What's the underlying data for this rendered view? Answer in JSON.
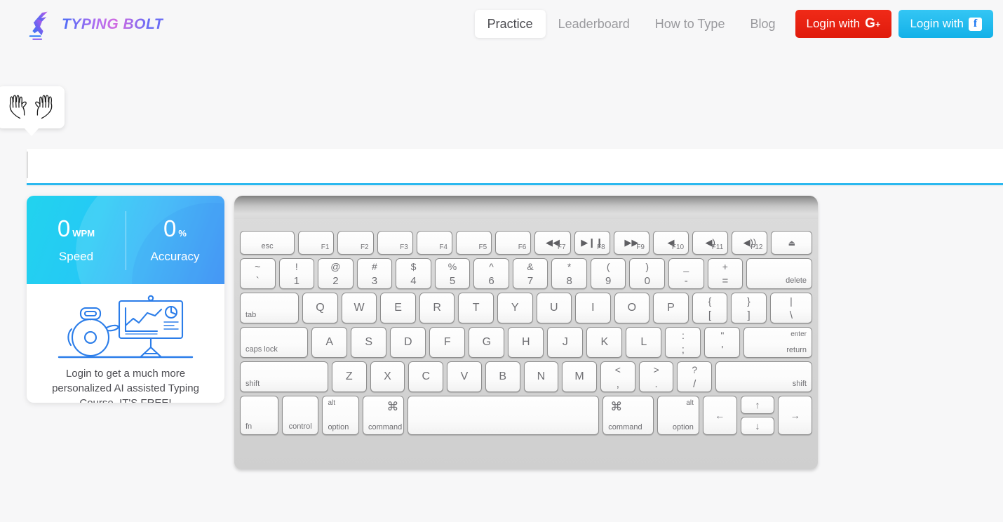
{
  "brand": {
    "name": "TYPING BOLT",
    "logo_icon": "runner-bolt-logo"
  },
  "nav": {
    "links": [
      {
        "label": "Practice",
        "active": true
      },
      {
        "label": "Leaderboard",
        "active": false
      },
      {
        "label": "How to Type",
        "active": false
      },
      {
        "label": "Blog",
        "active": false
      }
    ],
    "google_login": "Login with",
    "google_icon": "google-plus-icon",
    "facebook_login": "Login with",
    "facebook_icon": "facebook-icon"
  },
  "tooltip": {
    "icon": "two-hands-icon"
  },
  "typing_area": {
    "value": "",
    "placeholder": ""
  },
  "stats": {
    "speed": {
      "value": "0",
      "unit": "WPM",
      "label": "Speed"
    },
    "accuracy": {
      "value": "0",
      "unit": "%",
      "label": "Accuracy"
    }
  },
  "promo": {
    "illustration": "robot-presentation-chart-illustration",
    "text": "Login to get a much more personalized AI assisted Typing Course. IT'S FREE!"
  },
  "keyboard": {
    "function_row": [
      {
        "main": "esc",
        "style": "center-small",
        "flex": 1.55
      },
      {
        "fnum": "F1",
        "style": "fkey",
        "flex": 1
      },
      {
        "fnum": "F2",
        "style": "fkey",
        "flex": 1
      },
      {
        "fnum": "F3",
        "style": "fkey",
        "flex": 1
      },
      {
        "fnum": "F4",
        "style": "fkey",
        "flex": 1
      },
      {
        "fnum": "F5",
        "style": "fkey",
        "flex": 1
      },
      {
        "fnum": "F6",
        "style": "fkey",
        "flex": 1
      },
      {
        "fnum": "F7",
        "glyph": "◀◀",
        "icon": "rewind-icon",
        "style": "media",
        "flex": 1
      },
      {
        "fnum": "F8",
        "glyph": "▶❙❙",
        "icon": "play-pause-icon",
        "style": "media",
        "flex": 1
      },
      {
        "fnum": "F9",
        "glyph": "▶▶",
        "icon": "fast-forward-icon",
        "style": "media",
        "flex": 1
      },
      {
        "fnum": "F10",
        "glyph": "◀",
        "icon": "mute-icon",
        "style": "media",
        "flex": 1
      },
      {
        "fnum": "F11",
        "glyph": "◀)",
        "icon": "volume-down-icon",
        "style": "media",
        "flex": 1
      },
      {
        "fnum": "F12",
        "glyph": "◀))",
        "icon": "volume-up-icon",
        "style": "media",
        "flex": 1
      },
      {
        "glyph": "⏏",
        "icon": "eject-icon",
        "style": "center",
        "flex": 1.15
      }
    ],
    "number_row": [
      {
        "top": "~",
        "bot": "`",
        "flex": 1
      },
      {
        "top": "!",
        "bot": "1",
        "flex": 1
      },
      {
        "top": "@",
        "bot": "2",
        "flex": 1
      },
      {
        "top": "#",
        "bot": "3",
        "flex": 1
      },
      {
        "top": "$",
        "bot": "4",
        "flex": 1
      },
      {
        "top": "%",
        "bot": "5",
        "flex": 1
      },
      {
        "top": "^",
        "bot": "6",
        "flex": 1
      },
      {
        "top": "&",
        "bot": "7",
        "flex": 1
      },
      {
        "top": "*",
        "bot": "8",
        "flex": 1
      },
      {
        "top": "(",
        "bot": "9",
        "flex": 1
      },
      {
        "top": ")",
        "bot": "0",
        "flex": 1
      },
      {
        "top": "_",
        "bot": "-",
        "flex": 1
      },
      {
        "top": "+",
        "bot": "=",
        "flex": 1
      },
      {
        "main": "delete",
        "style": "pos-br",
        "flex": 1.75
      }
    ],
    "tab_row": [
      {
        "main": "tab",
        "style": "pos-bl",
        "flex": 1.55
      },
      {
        "main": "Q",
        "flex": 1
      },
      {
        "main": "W",
        "flex": 1
      },
      {
        "main": "E",
        "flex": 1
      },
      {
        "main": "R",
        "flex": 1
      },
      {
        "main": "T",
        "flex": 1
      },
      {
        "main": "Y",
        "flex": 1
      },
      {
        "main": "U",
        "flex": 1
      },
      {
        "main": "I",
        "flex": 1
      },
      {
        "main": "O",
        "flex": 1
      },
      {
        "main": "P",
        "flex": 1
      },
      {
        "top": "{",
        "bot": "[",
        "flex": 1
      },
      {
        "top": "}",
        "bot": "]",
        "flex": 1
      },
      {
        "top": "|",
        "bot": "\\",
        "flex": 1.2
      }
    ],
    "home_row": [
      {
        "main": "caps lock",
        "style": "pos-bl",
        "flex": 1.8
      },
      {
        "main": "A",
        "flex": 1
      },
      {
        "main": "S",
        "flex": 1
      },
      {
        "main": "D",
        "flex": 1
      },
      {
        "main": "F",
        "flex": 1
      },
      {
        "main": "G",
        "flex": 1
      },
      {
        "main": "H",
        "flex": 1
      },
      {
        "main": "J",
        "flex": 1
      },
      {
        "main": "K",
        "flex": 1
      },
      {
        "main": "L",
        "flex": 1
      },
      {
        "top": ":",
        "bot": ";",
        "flex": 1
      },
      {
        "top": "\"",
        "bot": "'",
        "flex": 1
      },
      {
        "tr": "enter",
        "br": "return",
        "style": "enter",
        "flex": 1.95
      }
    ],
    "shift_row": [
      {
        "main": "shift",
        "style": "pos-bl",
        "flex": 2.45
      },
      {
        "main": "Z",
        "flex": 1
      },
      {
        "main": "X",
        "flex": 1
      },
      {
        "main": "C",
        "flex": 1
      },
      {
        "main": "V",
        "flex": 1
      },
      {
        "main": "B",
        "flex": 1
      },
      {
        "main": "N",
        "flex": 1
      },
      {
        "main": "M",
        "flex": 1
      },
      {
        "top": "<",
        "bot": ",",
        "flex": 1
      },
      {
        "top": ">",
        "bot": ".",
        "flex": 1
      },
      {
        "top": "?",
        "bot": "/",
        "flex": 1
      },
      {
        "main": "shift",
        "style": "pos-br",
        "flex": 2.7
      }
    ],
    "bottom_row": [
      {
        "main": "fn",
        "style": "pos-bl",
        "flex": 1
      },
      {
        "main": "control",
        "style": "pos-bc",
        "flex": 1.1
      },
      {
        "tl": "alt",
        "bl": "option",
        "style": "corner",
        "flex": 1.1
      },
      {
        "cmd": "⌘",
        "bl": "command",
        "style": "cmd-left",
        "flex": 1.25
      },
      {
        "main": "",
        "style": "space",
        "flex": 5.9
      },
      {
        "cmd": "⌘",
        "bl": "command",
        "style": "cmd-left",
        "flex": 1.55
      },
      {
        "tr": "alt",
        "br": "option",
        "style": "corner-right",
        "flex": 1.25
      }
    ],
    "arrow_keys": {
      "left": "←",
      "up": "↑",
      "down": "↓",
      "right": "→"
    }
  },
  "colors": {
    "accent_cyan": "#2bb8ef",
    "google_red": "#e01b0c",
    "facebook_blue": "#13b1e8",
    "page_bg": "#f7f7f8"
  }
}
